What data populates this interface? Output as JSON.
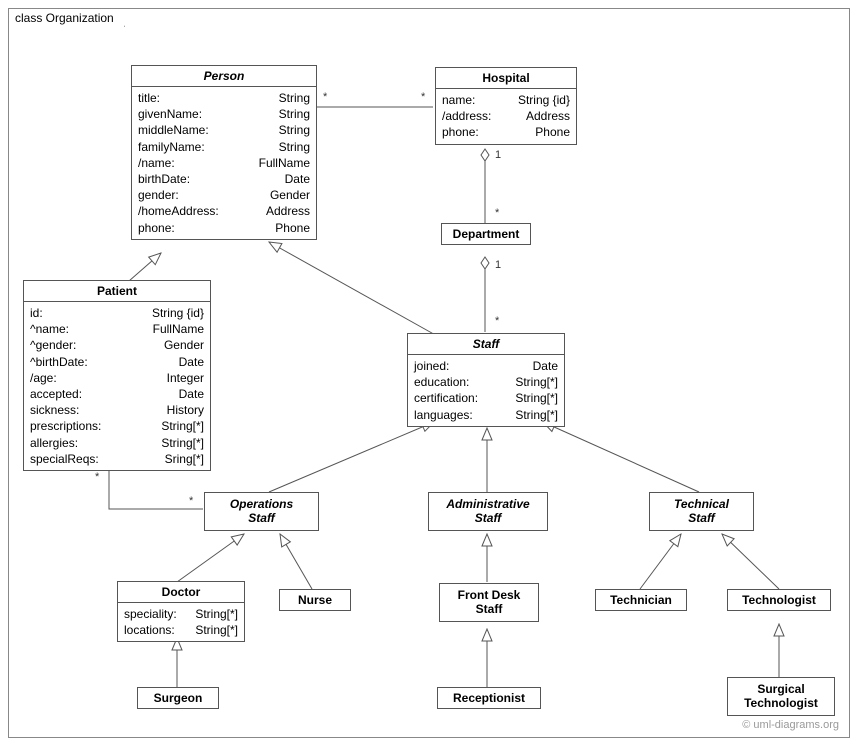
{
  "frame": {
    "title": "class Organization"
  },
  "copyright": "© uml-diagrams.org",
  "classes": {
    "person": {
      "name": "Person",
      "attrs": [
        {
          "name": "title:",
          "type": "String"
        },
        {
          "name": "givenName:",
          "type": "String"
        },
        {
          "name": "middleName:",
          "type": "String"
        },
        {
          "name": "familyName:",
          "type": "String"
        },
        {
          "name": "/name:",
          "type": "FullName"
        },
        {
          "name": "birthDate:",
          "type": "Date"
        },
        {
          "name": "gender:",
          "type": "Gender"
        },
        {
          "name": "/homeAddress:",
          "type": "Address"
        },
        {
          "name": "phone:",
          "type": "Phone"
        }
      ]
    },
    "hospital": {
      "name": "Hospital",
      "attrs": [
        {
          "name": "name:",
          "type": "String {id}"
        },
        {
          "name": "/address:",
          "type": "Address"
        },
        {
          "name": "phone:",
          "type": "Phone"
        }
      ]
    },
    "department": {
      "name": "Department"
    },
    "patient": {
      "name": "Patient",
      "attrs": [
        {
          "name": "id:",
          "type": "String {id}"
        },
        {
          "name": "^name:",
          "type": "FullName"
        },
        {
          "name": "^gender:",
          "type": "Gender"
        },
        {
          "name": "^birthDate:",
          "type": "Date"
        },
        {
          "name": "/age:",
          "type": "Integer"
        },
        {
          "name": "accepted:",
          "type": "Date"
        },
        {
          "name": "sickness:",
          "type": "History"
        },
        {
          "name": "prescriptions:",
          "type": "String[*]"
        },
        {
          "name": "allergies:",
          "type": "String[*]"
        },
        {
          "name": "specialReqs:",
          "type": "Sring[*]"
        }
      ]
    },
    "staff": {
      "name": "Staff",
      "attrs": [
        {
          "name": "joined:",
          "type": "Date"
        },
        {
          "name": "education:",
          "type": "String[*]"
        },
        {
          "name": "certification:",
          "type": "String[*]"
        },
        {
          "name": "languages:",
          "type": "String[*]"
        }
      ]
    },
    "opsStaff": {
      "name": "Operations",
      "sub": "Staff"
    },
    "adminStaff": {
      "name": "Administrative",
      "sub": "Staff"
    },
    "techStaff": {
      "name": "Technical",
      "sub": "Staff"
    },
    "doctor": {
      "name": "Doctor",
      "attrs": [
        {
          "name": "speciality:",
          "type": "String[*]"
        },
        {
          "name": "locations:",
          "type": "String[*]"
        }
      ]
    },
    "nurse": {
      "name": "Nurse"
    },
    "frontDesk": {
      "name": "Front Desk",
      "sub": "Staff"
    },
    "technician": {
      "name": "Technician"
    },
    "technologist": {
      "name": "Technologist"
    },
    "surgeon": {
      "name": "Surgeon"
    },
    "receptionist": {
      "name": "Receptionist"
    },
    "surgTech": {
      "name": "Surgical",
      "sub": "Technologist"
    }
  },
  "multiplicities": {
    "personHospitalL": "*",
    "personHospitalR": "*",
    "hospitalDept": "1",
    "deptHospital": "*",
    "deptStaff": "1",
    "staffDept": "*",
    "patientOps": "*",
    "opsPatient": "*"
  }
}
